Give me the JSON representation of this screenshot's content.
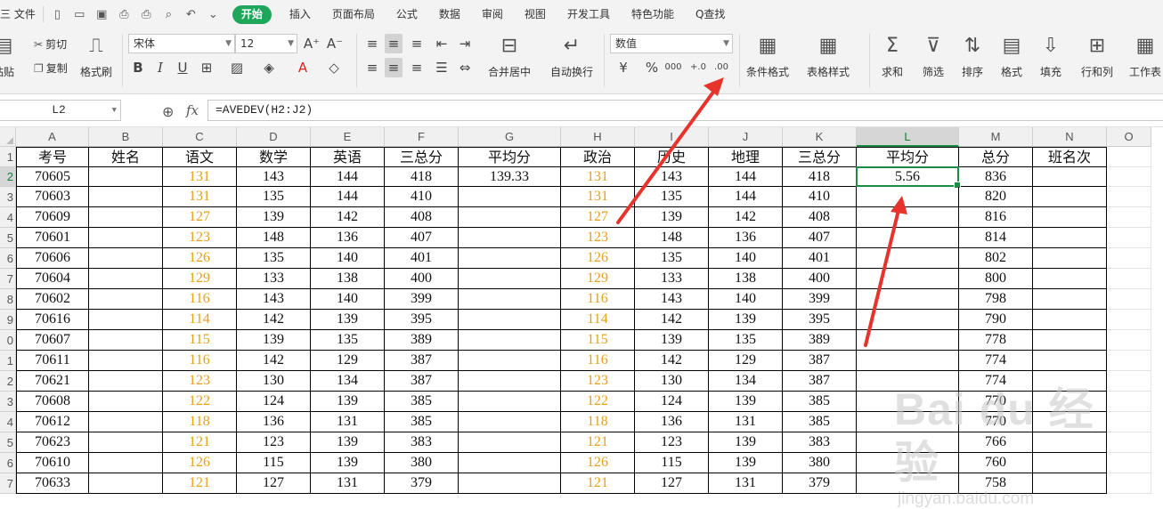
{
  "menubar": {
    "file": "三 文件",
    "quick_icons": [
      "new-doc-icon",
      "open-folder-icon",
      "save-icon",
      "print-preview-icon",
      "print-icon",
      "preview-icon",
      "undo-icon",
      "more-icon"
    ],
    "start_label": "开始",
    "tabs": [
      "插入",
      "页面布局",
      "公式",
      "数据",
      "审阅",
      "视图",
      "开发工具",
      "特色功能"
    ],
    "search_label": "Q查找"
  },
  "ribbon": {
    "paste": "粘贴",
    "cut": "剪切",
    "copy": "复制",
    "format_painter": "格式刷",
    "font_name": "宋体",
    "font_size": "12",
    "bold": "B",
    "italic": "I",
    "underline": "U",
    "merge_center": "合并居中",
    "wrap_text": "自动换行",
    "number_format": "数值",
    "percent": "%",
    "thousands": "000",
    "increase_decimal": "+.0",
    "decrease_decimal": ".00",
    "conditional_format": "条件格式",
    "table_style": "表格样式",
    "sum": "求和",
    "filter": "筛选",
    "sort": "排序",
    "format": "格式",
    "fill": "填充",
    "row_col": "行和列",
    "worksheet": "工作表"
  },
  "formula_bar": {
    "name_box": "L2",
    "fx": "fx",
    "formula": "=AVEDEV(H2:J2)"
  },
  "grid": {
    "columns": [
      "A",
      "B",
      "C",
      "D",
      "E",
      "F",
      "G",
      "H",
      "I",
      "J",
      "K",
      "L",
      "M",
      "N",
      "O"
    ],
    "selected_column": "L",
    "row_numbers": [
      "1",
      "2",
      "3",
      "4",
      "5",
      "6",
      "7",
      "8",
      "9",
      "0",
      "1",
      "2",
      "3",
      "4",
      "5",
      "6",
      "7"
    ],
    "headers": [
      "考号",
      "姓名",
      "语文",
      "数学",
      "英语",
      "三总分",
      "平均分",
      "政治",
      "历史",
      "地理",
      "三总分",
      "平均分",
      "总分",
      "班名次"
    ],
    "rows": [
      [
        "70605",
        "",
        "131",
        "143",
        "144",
        "418",
        "139.33",
        "131",
        "143",
        "144",
        "418",
        "5.56",
        "836",
        ""
      ],
      [
        "70603",
        "",
        "131",
        "135",
        "144",
        "410",
        "",
        "131",
        "135",
        "144",
        "410",
        "",
        "820",
        ""
      ],
      [
        "70609",
        "",
        "127",
        "139",
        "142",
        "408",
        "",
        "127",
        "139",
        "142",
        "408",
        "",
        "816",
        ""
      ],
      [
        "70601",
        "",
        "123",
        "148",
        "136",
        "407",
        "",
        "123",
        "148",
        "136",
        "407",
        "",
        "814",
        ""
      ],
      [
        "70606",
        "",
        "126",
        "135",
        "140",
        "401",
        "",
        "126",
        "135",
        "140",
        "401",
        "",
        "802",
        ""
      ],
      [
        "70604",
        "",
        "129",
        "133",
        "138",
        "400",
        "",
        "129",
        "133",
        "138",
        "400",
        "",
        "800",
        ""
      ],
      [
        "70602",
        "",
        "116",
        "143",
        "140",
        "399",
        "",
        "116",
        "143",
        "140",
        "399",
        "",
        "798",
        ""
      ],
      [
        "70616",
        "",
        "114",
        "142",
        "139",
        "395",
        "",
        "114",
        "142",
        "139",
        "395",
        "",
        "790",
        ""
      ],
      [
        "70607",
        "",
        "115",
        "139",
        "135",
        "389",
        "",
        "115",
        "139",
        "135",
        "389",
        "",
        "778",
        ""
      ],
      [
        "70611",
        "",
        "116",
        "142",
        "129",
        "387",
        "",
        "116",
        "142",
        "129",
        "387",
        "",
        "774",
        ""
      ],
      [
        "70621",
        "",
        "123",
        "130",
        "134",
        "387",
        "",
        "123",
        "130",
        "134",
        "387",
        "",
        "774",
        ""
      ],
      [
        "70608",
        "",
        "122",
        "124",
        "139",
        "385",
        "",
        "122",
        "124",
        "139",
        "385",
        "",
        "770",
        ""
      ],
      [
        "70612",
        "",
        "118",
        "136",
        "131",
        "385",
        "",
        "118",
        "136",
        "131",
        "385",
        "",
        "770",
        ""
      ],
      [
        "70623",
        "",
        "121",
        "123",
        "139",
        "383",
        "",
        "121",
        "123",
        "139",
        "383",
        "",
        "766",
        ""
      ],
      [
        "70610",
        "",
        "126",
        "115",
        "139",
        "380",
        "",
        "126",
        "115",
        "139",
        "380",
        "",
        "760",
        ""
      ],
      [
        "70633",
        "",
        "121",
        "127",
        "131",
        "379",
        "",
        "121",
        "127",
        "131",
        "379",
        "",
        "758",
        ""
      ]
    ],
    "orange_columns": [
      2,
      7
    ],
    "orange_color": "#e6a11a",
    "selection_color": "#1e8c47",
    "arrow_color": "#e8322c"
  },
  "watermark": {
    "line1": "Bai du 经验",
    "line2": "jingyan.baidu.com"
  }
}
